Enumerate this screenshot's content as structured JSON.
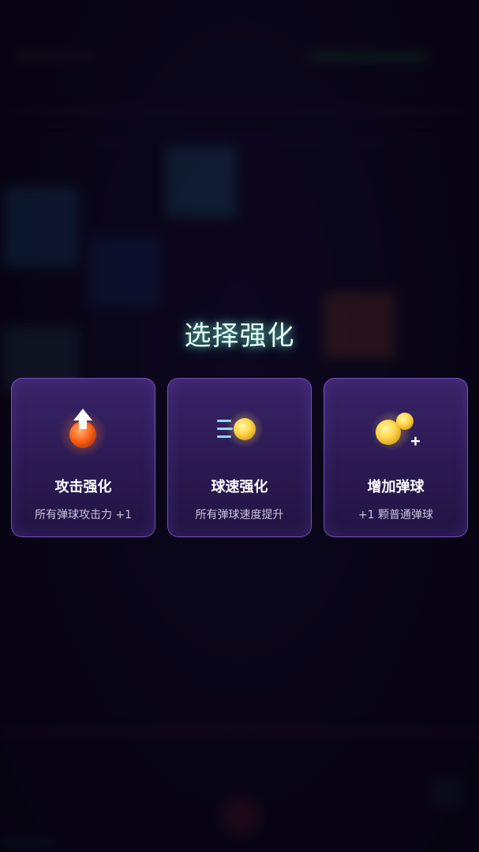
{
  "screen": {
    "title": "选择强化"
  },
  "upgrades": [
    {
      "name": "攻击强化",
      "desc": "所有弹球攻击力 +1",
      "icon": "attack-up-icon"
    },
    {
      "name": "球速强化",
      "desc": "所有弹球速度提升",
      "icon": "ball-speed-icon"
    },
    {
      "name": "增加弹球",
      "desc": "+1 颗普通弹球",
      "icon": "add-ball-icon"
    }
  ],
  "colors": {
    "title_glow": "#78ffdc",
    "card_border": "#9670e6",
    "card_bg": "#2a1a52",
    "ball_yellow": "#ffd84a",
    "ball_orange": "#ff7a2a"
  }
}
